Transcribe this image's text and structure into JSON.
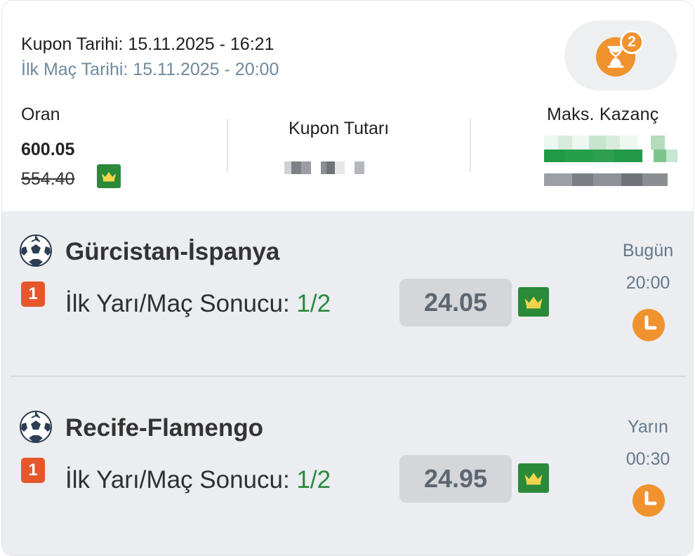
{
  "header": {
    "coupon_date_label": "Kupon Tarihi: 15.11.2025 - 16:21",
    "first_match_date_label": "İlk Maç Tarihi: 15.11.2025 - 20:00",
    "timer_badge_count": "2",
    "odds_label": "Oran",
    "odds_value": "600.05",
    "odds_old_value": "554.40",
    "stake_label": "Kupon Tutarı",
    "max_win_label": "Maks. Kazanç"
  },
  "matches": [
    {
      "title": "Gürcistan-İspanya",
      "pick_number": "1",
      "market": "İlk Yarı/Maç Sonucu: ",
      "selection": "1/2",
      "odd": "24.05",
      "day": "Bugün",
      "time": "20:00"
    },
    {
      "title": "Recife-Flamengo",
      "pick_number": "1",
      "market": "İlk Yarı/Maç Sonucu: ",
      "selection": "1/2",
      "odd": "24.95",
      "day": "Yarın",
      "time": "00:30"
    }
  ],
  "colors": {
    "accent_orange": "#f0922e",
    "pick_red": "#e5572a",
    "selection_green": "#2b8a3e",
    "crown_green": "#2a8a3a"
  },
  "icons": {
    "timer": "hourglass-icon",
    "crown": "crown-icon",
    "ball": "soccer-ball-icon",
    "clock": "clock-icon"
  }
}
